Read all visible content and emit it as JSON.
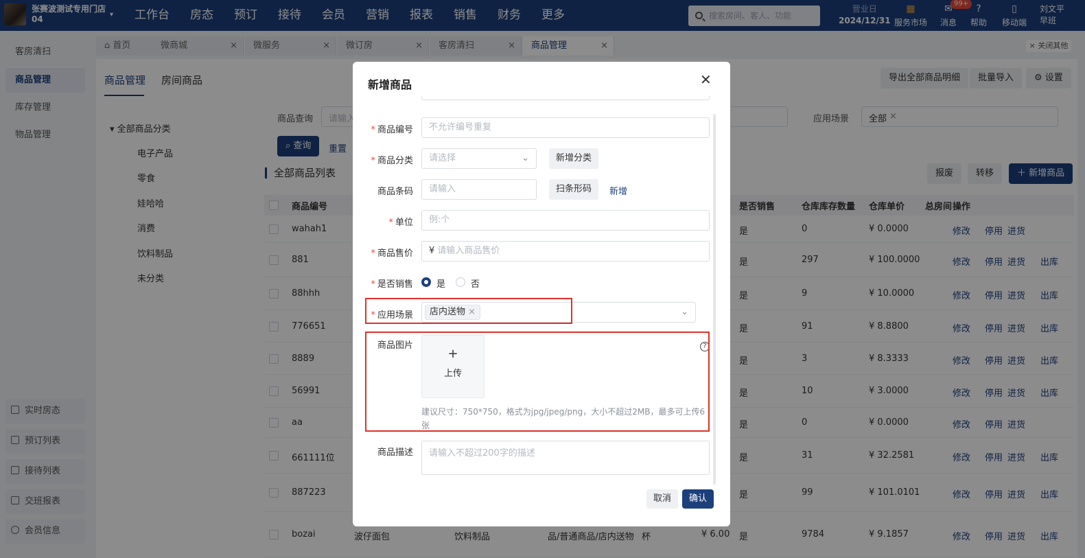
{
  "store": {
    "name": "张赛波测试专用门店",
    "code": "04"
  },
  "nav": [
    "工作台",
    "房态",
    "预订",
    "接待",
    "会员",
    "营销",
    "报表",
    "销售",
    "财务",
    "更多"
  ],
  "search": {
    "placeholder": "搜索房间、客人、功能"
  },
  "bizday": {
    "label": "营业日",
    "date": "2024/12/31"
  },
  "topicons": {
    "market": "服务市场",
    "msg": "消息",
    "msg_badge": "99+",
    "help": "帮助",
    "mobile": "移动端"
  },
  "user": {
    "name": "刘文平",
    "shift": "早班"
  },
  "sidebar": {
    "items": [
      "客房清扫",
      "商品管理",
      "库存管理",
      "物品管理"
    ],
    "bottom": [
      "实时房态",
      "预订列表",
      "接待列表",
      "交班报表",
      "会员信息"
    ]
  },
  "tabs": [
    {
      "label": "首页"
    },
    {
      "label": "微商城"
    },
    {
      "label": "微服务"
    },
    {
      "label": "微订房"
    },
    {
      "label": "客房清扫"
    },
    {
      "label": "商品管理"
    }
  ],
  "closeother": "× 关闭其他",
  "subtabs": [
    "商品管理",
    "房间商品"
  ],
  "actions": {
    "export": "导出全部商品明细",
    "import": "批量导入",
    "settings": "设置",
    "add": "＋ 新增商品",
    "loss": "报废",
    "transfer": "转移"
  },
  "tree": {
    "root": "全部商品分类",
    "children": [
      "电子产品",
      "零食",
      "娃哈哈",
      "消费",
      "饮料制品",
      "未分类"
    ]
  },
  "filter": {
    "query_label": "商品查询",
    "query_placeholder": "请输入",
    "scene_label": "应用场景",
    "scene_value": "全部",
    "query_btn": "查询",
    "reset_btn": "重置"
  },
  "list_title": "全部商品列表",
  "table": {
    "headers": {
      "code": "商品编号",
      "sale": "是否销售",
      "stock": "仓库库存数量",
      "price": "仓库单价",
      "total": "总房间",
      "ops": "操作"
    },
    "rows": [
      {
        "code": "wahah1",
        "sale": "是",
        "stock": "0",
        "price": "¥ 0.0000",
        "out": false
      },
      {
        "code": "881",
        "sale": "是",
        "stock": "297",
        "price": "¥ 100.0000",
        "out": true
      },
      {
        "code": "88hhh",
        "sale": "是",
        "stock": "9",
        "price": "¥ 10.0000",
        "out": true
      },
      {
        "code": "776651",
        "sale": "是",
        "stock": "91",
        "price": "¥ 8.8800",
        "out": true
      },
      {
        "code": "8889",
        "sale": "是",
        "stock": "3",
        "price": "¥ 8.3333",
        "out": true
      },
      {
        "code": "56991",
        "sale": "是",
        "stock": "10",
        "price": "¥ 3.0000",
        "out": true
      },
      {
        "code": "aa",
        "sale": "是",
        "stock": "0",
        "price": "¥ 0.0000",
        "out": false
      },
      {
        "code": "661111位",
        "sale": "是",
        "stock": "31",
        "price": "¥ 32.2581",
        "out": true
      },
      {
        "code": "887223",
        "sale": "是",
        "stock": "99",
        "price": "¥ 101.0101",
        "out": true
      },
      {
        "code": "bozai",
        "sale": "是",
        "stock": "9784",
        "price": "¥ 9.1857",
        "out": true
      }
    ],
    "ops": {
      "edit": "修改",
      "stop": "停用",
      "buy": "进货",
      "out": "出库"
    },
    "last_row": {
      "name": "波仔面包",
      "cat": "饮料制品",
      "scene": "品/普通商品/店内送物",
      "unit": "杯",
      "sale_price": "¥ 6.00"
    }
  },
  "modal": {
    "title": "新增商品",
    "fields": {
      "code": {
        "label": "商品编号",
        "placeholder": "不允许编号重复"
      },
      "category": {
        "label": "商品分类",
        "placeholder": "请选择",
        "btn": "新增分类"
      },
      "barcode": {
        "label": "商品条码",
        "placeholder": "请输入",
        "btn": "扫条形码",
        "link": "新增"
      },
      "unit": {
        "label": "单位",
        "placeholder": "例:个"
      },
      "price": {
        "label": "商品售价",
        "prefix": "¥",
        "placeholder": "请输入商品售价"
      },
      "on_sale": {
        "label": "是否销售",
        "yes": "是",
        "no": "否"
      },
      "scene": {
        "label": "应用场景",
        "tag": "店内送物"
      },
      "image": {
        "label": "商品图片",
        "upload": "上传",
        "hint": "建议尺寸：750*750，格式为jpg/jpeg/png，大小不超过2MB，最多可上传6张"
      },
      "desc": {
        "label": "商品描述",
        "placeholder": "请输入不超过200字的描述"
      }
    },
    "cancel": "取消",
    "confirm": "确认"
  },
  "colors": {
    "primary": "#1d3f7c",
    "highlight": "#e0302a"
  }
}
